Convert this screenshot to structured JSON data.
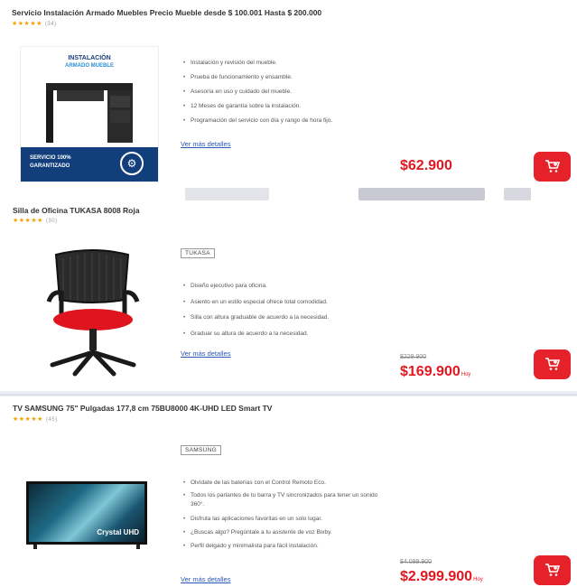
{
  "products": [
    {
      "title": "Servicio Instalación Armado Muebles Precio Mueble desde $ 100.001 Hasta $ 200.000",
      "stars": "★★★★★",
      "reviews": "(34)",
      "image": {
        "headline1": "INSTALACIÓN",
        "headline2": "ARMADO MUEBLE",
        "badge1": "SERVICIO 100%",
        "badge2": "GARANTIZADO"
      },
      "features": [
        "Instalación y revisión del mueble.",
        "Prueba de funcionamiento y ensamble.",
        "Asesoría en uso y cuidado del mueble.",
        "12 Meses de garantía sobre la instalación.",
        "Programación del servicio con día y rango de hora fijo."
      ],
      "more_link": "Ver más detalles",
      "price": "$62.900"
    },
    {
      "title": "Silla de Oficina TUKASA 8008 Roja",
      "stars": "★★★★★",
      "reviews": "(30)",
      "brand": "TUKASA",
      "features": [
        "Diseño ejecutivo para oficina.",
        "Asiento en un estilo especial ofrece total comodidad.",
        "Silla con altura graduable de acuerdo a la necesidad.",
        "Graduar su altura de acuerdo a la necesidad."
      ],
      "more_link": "Ver más detalles",
      "old_price": "$229.900",
      "price": "$169.900",
      "unit": "Hoy"
    },
    {
      "title": "TV SAMSUNG 75\" Pulgadas 177,8 cm 75BU8000 4K-UHD LED Smart TV",
      "stars": "★★★★★",
      "reviews": "(45)",
      "brand": "SAMSUNG",
      "features": [
        "Olvídate de las baterías con el Control Remoto Eco.",
        "Todos los parlantes de tu barra y TV sincronizados para tener un sonido 360°.",
        "Disfruta las aplicaciones favoritas en un solo lugar.",
        "¿Buscas algo? Pregúntale a tu asistente de voz Bixby.",
        "Perfil delgado y minimalista para fácil instalación."
      ],
      "more_link": "Ver más detalles",
      "old_price": "$4.099.900",
      "price": "$2.999.900",
      "unit": "Hoy",
      "screen_text": "Crystal UHD"
    }
  ],
  "colors": {
    "price": "#e1181f",
    "cart": "#e5212a",
    "link": "#2857b5",
    "stars": "#f2a100"
  }
}
